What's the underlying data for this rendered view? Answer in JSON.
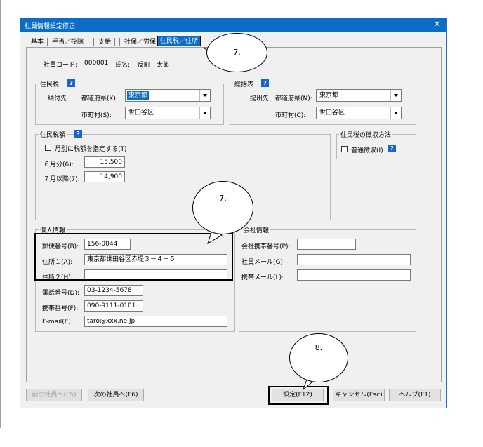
{
  "window": {
    "title": "社員情報設定修正",
    "close_glyph": "×"
  },
  "tabs": [
    {
      "label": "基本"
    },
    {
      "label": "手当／控除"
    },
    {
      "label": "支給"
    },
    {
      "label": "社保／労保"
    },
    {
      "label": "住民税／住所",
      "selected": true
    }
  ],
  "employee": {
    "code_label": "社員コード:",
    "code": "000001",
    "name_label": "氏名:",
    "name": "反町　太郎"
  },
  "juminzei": {
    "group_title": "住民税",
    "help": "?",
    "payee_label": "納付先",
    "pref_label": "都道府県(K):",
    "pref_value": "東京都",
    "city_label": "市町村(S):",
    "city_value": "世田谷区"
  },
  "soukatsu": {
    "group_title": "総括表",
    "help": "?",
    "submit_label": "提出先",
    "pref_label": "都道府県(N):",
    "pref_value": "東京都",
    "city_label": "市町村(C):",
    "city_value": "世田谷区"
  },
  "amount": {
    "group_title": "住民税額",
    "help": "?",
    "monthly_check_label": "月別に税額を指定する(T)",
    "june_label": "６月分(6):",
    "june_value": "15,500",
    "july_label": "７月以降(7):",
    "july_value": "14,900"
  },
  "collection": {
    "group_title": "住民税の徴収方法",
    "normal_label": "普通徴収(I)",
    "help": "?"
  },
  "personal": {
    "group_title": "個人情報",
    "zip_label": "郵便番号(B):",
    "zip_value": "156-0044",
    "addr1_label": "住所１(A):",
    "addr1_value": "東京都世田谷区赤堤３－４－５",
    "addr2_label": "住所２(H):",
    "addr2_value": "",
    "phone_label": "電話番号(D):",
    "phone_value": "03-1234-5678",
    "mobile_label": "携帯番号(F):",
    "mobile_value": "090-9111-0101",
    "email_label": "E-mail(E):",
    "email_value": "taro@xxx.ne.jp"
  },
  "company": {
    "group_title": "会社情報",
    "mobile_label": "会社携帯番号(P):",
    "mobile_value": "",
    "email_label": "社員メール(G):",
    "email_value": "",
    "mobile_email_label": "携帯メール(L):",
    "mobile_email_value": ""
  },
  "buttons": {
    "prev": "前の社員へ(F5)",
    "next": "次の社員へ(F6)",
    "save": "設定(F12)",
    "cancel": "キャンセル(Esc)",
    "help": "ヘルプ(F1)"
  },
  "callouts": {
    "tab": "7.",
    "personal": "7.",
    "save": "8."
  },
  "colors": {
    "accent": "#0c6dc7",
    "highlight_border": "#000000"
  }
}
